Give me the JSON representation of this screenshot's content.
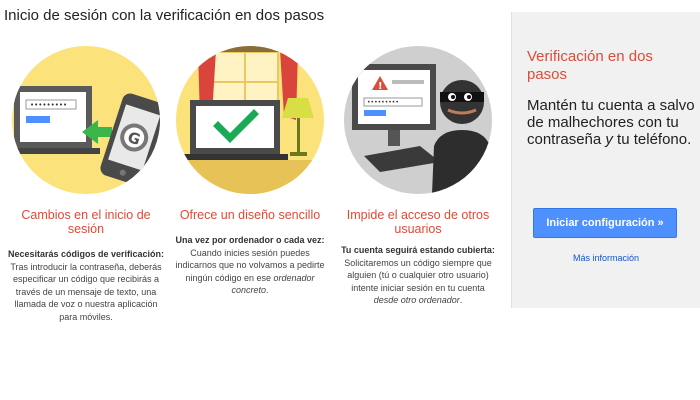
{
  "page": {
    "title": "Inicio de sesión con la verificación en dos pasos"
  },
  "features": [
    {
      "title": "Cambios en el inicio de sesión",
      "lead": "Necesitarás códigos de verificación:",
      "text": "Tras introducir la contraseña, deberás especificar un código que recibirás a través de un mensaje de texto, una llamada de voz o nuestra aplicación para móviles.",
      "icon": "phone-sends-code-illustration"
    },
    {
      "title": "Ofrece un diseño sencillo",
      "lead": "Una vez por ordenador o cada vez:",
      "text_before": "Cuando inicies sesión puedes indicarnos que no volvamos a pedirte ningún código en ese ",
      "text_em": "ordenador concreto",
      "text_after": ".",
      "icon": "trusted-computer-illustration"
    },
    {
      "title": "Impide el acceso de otros usuarios",
      "lead": "Tu cuenta seguirá estando cubierta:",
      "text_before": "Solicitaremos un código siempre que alguien (tú o cualquier otro usuario) intente iniciar sesión en tu cuenta ",
      "text_em": "desde otro ordenador",
      "text_after": ".",
      "icon": "thief-blocked-illustration"
    }
  ],
  "panel": {
    "title": "Verificación en dos pasos",
    "text_before": "Mantén tu cuenta a salvo de malhechores con tu contraseña ",
    "text_em": "y",
    "text_after": " tu teléfono.",
    "button_label": "Iniciar configuración »",
    "more_link": "Más información"
  },
  "colors": {
    "accent_red": "#dd4b39",
    "button_blue": "#4d90fe",
    "link_blue": "#1155cc",
    "circle_yellow": "#fbe27a",
    "circle_gray": "#cfcfcf"
  }
}
